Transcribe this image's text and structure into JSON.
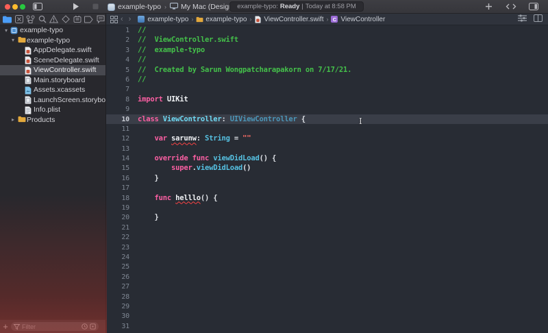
{
  "titlebar": {
    "traffic": {
      "close": "#FF5F57",
      "minimize": "#FEBC2E",
      "zoom": "#28C840"
    },
    "scheme": {
      "project": "example-typo",
      "separator": "›",
      "destination": "My Mac (Designed for iPad)"
    },
    "status": {
      "project": "example-typo:",
      "state": "Ready",
      "divider": "|",
      "detail": "Today at 8:58 PM"
    },
    "icons": [
      "sidebar-toggle-icon",
      "run-play-icon",
      "stop-icon",
      "add-plus-icon",
      "code-review-icon",
      "inspector-toggle-icon"
    ]
  },
  "navigator": {
    "selected_index": 0,
    "tabs": [
      {
        "name": "project-navigator",
        "icon": "folder-icon"
      },
      {
        "name": "source-control-navigator",
        "icon": "source-control-icon"
      },
      {
        "name": "symbol-navigator",
        "icon": "symbols-icon"
      },
      {
        "name": "find-navigator",
        "icon": "search-icon"
      },
      {
        "name": "issue-navigator",
        "icon": "warning-triangle-icon"
      },
      {
        "name": "test-navigator",
        "icon": "diamond-icon"
      },
      {
        "name": "debug-navigator",
        "icon": "debug-gauge-icon"
      },
      {
        "name": "breakpoint-navigator",
        "icon": "breakpoint-tag-icon"
      },
      {
        "name": "report-navigator",
        "icon": "report-bubble-icon"
      }
    ]
  },
  "jumpbar": {
    "related_icon": "related-items-grid-icon",
    "back": "‹",
    "forward": "›",
    "crumbs": [
      {
        "label": "example-typo",
        "icon": "app-project-icon"
      },
      {
        "label": "example-typo",
        "icon": "folder-icon"
      },
      {
        "label": "ViewController.swift",
        "icon": "swift-file-icon"
      },
      {
        "label": "ViewController",
        "icon": "class-symbol-icon",
        "badge": "C"
      }
    ],
    "separator": "›",
    "right_icons": [
      "editor-options-icon",
      "add-editor-icon"
    ]
  },
  "sidebar": {
    "items": [
      {
        "label": "example-typo",
        "type": "project",
        "depth": 0,
        "disclosure": "open",
        "selected": false
      },
      {
        "label": "example-typo",
        "type": "folder",
        "depth": 1,
        "disclosure": "open",
        "selected": false
      },
      {
        "label": "AppDelegate.swift",
        "type": "swift",
        "depth": 2,
        "selected": false
      },
      {
        "label": "SceneDelegate.swift",
        "type": "swift",
        "depth": 2,
        "selected": false
      },
      {
        "label": "ViewController.swift",
        "type": "swift",
        "depth": 2,
        "selected": true
      },
      {
        "label": "Main.storyboard",
        "type": "storyboard",
        "depth": 2,
        "selected": false
      },
      {
        "label": "Assets.xcassets",
        "type": "assets",
        "depth": 2,
        "selected": false
      },
      {
        "label": "LaunchScreen.storyboard",
        "type": "storyboard",
        "depth": 2,
        "selected": false
      },
      {
        "label": "Info.plist",
        "type": "plist",
        "depth": 2,
        "selected": false
      },
      {
        "label": "Products",
        "type": "folder",
        "depth": 1,
        "disclosure": "closed",
        "selected": false
      }
    ],
    "filter": {
      "add_label": "+",
      "placeholder": "Filter",
      "right_icons": [
        "clock-icon",
        "status-badge-icon"
      ]
    }
  },
  "editor": {
    "cursor_glyph": "I",
    "line_count": 31,
    "lines": [
      {
        "n": 1,
        "tokens": [
          {
            "t": "//",
            "c": "comment"
          }
        ]
      },
      {
        "n": 2,
        "tokens": [
          {
            "t": "//  ViewController.swift",
            "c": "comment"
          }
        ]
      },
      {
        "n": 3,
        "tokens": [
          {
            "t": "//  example-typo",
            "c": "comment"
          }
        ]
      },
      {
        "n": 4,
        "tokens": [
          {
            "t": "//",
            "c": "comment"
          }
        ]
      },
      {
        "n": 5,
        "tokens": [
          {
            "t": "//  Created by Sarun Wongpatcharapakorn on 7/17/21.",
            "c": "comment"
          }
        ]
      },
      {
        "n": 6,
        "tokens": [
          {
            "t": "//",
            "c": "comment"
          }
        ]
      },
      {
        "n": 7,
        "tokens": []
      },
      {
        "n": 8,
        "tokens": [
          {
            "t": "import",
            "c": "keyword"
          },
          {
            "t": " UIKit",
            "c": "ident"
          }
        ]
      },
      {
        "n": 9,
        "tokens": []
      },
      {
        "n": 10,
        "highlight": true,
        "tokens": [
          {
            "t": "class",
            "c": "keyword"
          },
          {
            "t": " ",
            "c": "plain"
          },
          {
            "t": "ViewController",
            "c": "typeDecl"
          },
          {
            "t": ": ",
            "c": "plain"
          },
          {
            "t": "UIViewController",
            "c": "typeRef"
          },
          {
            "t": " {",
            "c": "plain"
          }
        ]
      },
      {
        "n": 11,
        "tokens": []
      },
      {
        "n": 12,
        "tokens": [
          {
            "t": "    ",
            "c": "plain"
          },
          {
            "t": "var",
            "c": "keyword"
          },
          {
            "t": " ",
            "c": "plain"
          },
          {
            "t": "sarunw",
            "c": "ident",
            "u": true
          },
          {
            "t": ": ",
            "c": "plain"
          },
          {
            "t": "String",
            "c": "type"
          },
          {
            "t": " = ",
            "c": "plain"
          },
          {
            "t": "\"\"",
            "c": "string"
          }
        ]
      },
      {
        "n": 13,
        "tokens": []
      },
      {
        "n": 14,
        "tokens": [
          {
            "t": "    ",
            "c": "plain"
          },
          {
            "t": "override",
            "c": "keyword"
          },
          {
            "t": " ",
            "c": "plain"
          },
          {
            "t": "func",
            "c": "keyword"
          },
          {
            "t": " ",
            "c": "plain"
          },
          {
            "t": "viewDidLoad",
            "c": "type"
          },
          {
            "t": "() {",
            "c": "plain"
          }
        ]
      },
      {
        "n": 15,
        "tokens": [
          {
            "t": "        ",
            "c": "plain"
          },
          {
            "t": "super",
            "c": "keyword"
          },
          {
            "t": ".",
            "c": "plain"
          },
          {
            "t": "viewDidLoad",
            "c": "type"
          },
          {
            "t": "()",
            "c": "plain"
          }
        ]
      },
      {
        "n": 16,
        "tokens": [
          {
            "t": "    }",
            "c": "plain"
          }
        ]
      },
      {
        "n": 17,
        "tokens": []
      },
      {
        "n": 18,
        "tokens": [
          {
            "t": "    ",
            "c": "plain"
          },
          {
            "t": "func",
            "c": "keyword"
          },
          {
            "t": " ",
            "c": "plain"
          },
          {
            "t": "helllo",
            "c": "ident",
            "u": true
          },
          {
            "t": "() {",
            "c": "plain"
          }
        ]
      },
      {
        "n": 19,
        "tokens": []
      },
      {
        "n": 20,
        "tokens": [
          {
            "t": "    }",
            "c": "plain"
          }
        ]
      },
      {
        "n": 21,
        "tokens": []
      },
      {
        "n": 22,
        "tokens": []
      },
      {
        "n": 23,
        "tokens": []
      },
      {
        "n": 24,
        "tokens": []
      },
      {
        "n": 25,
        "tokens": []
      },
      {
        "n": 26,
        "tokens": []
      },
      {
        "n": 27,
        "tokens": []
      },
      {
        "n": 28,
        "tokens": []
      },
      {
        "n": 29,
        "tokens": []
      },
      {
        "n": 30,
        "tokens": []
      },
      {
        "n": 31,
        "tokens": []
      }
    ]
  },
  "colors": {
    "comment": "#44C04A",
    "keyword": "#FC5FA3",
    "typeDecl": "#6FD9F3",
    "type": "#56C1E2",
    "typeRef": "#4C96B8",
    "string": "#FF6E67",
    "plain": "#DFE2E7",
    "ident": "#F0F2F5",
    "editor_bg": "#282C34",
    "line_highlight": "#3A3E48",
    "sidebar_selection": "#47484F",
    "folder_accent": "#E2A83C",
    "navigator_accent": "#4B9EF8",
    "error_underline": "#FF4444"
  }
}
